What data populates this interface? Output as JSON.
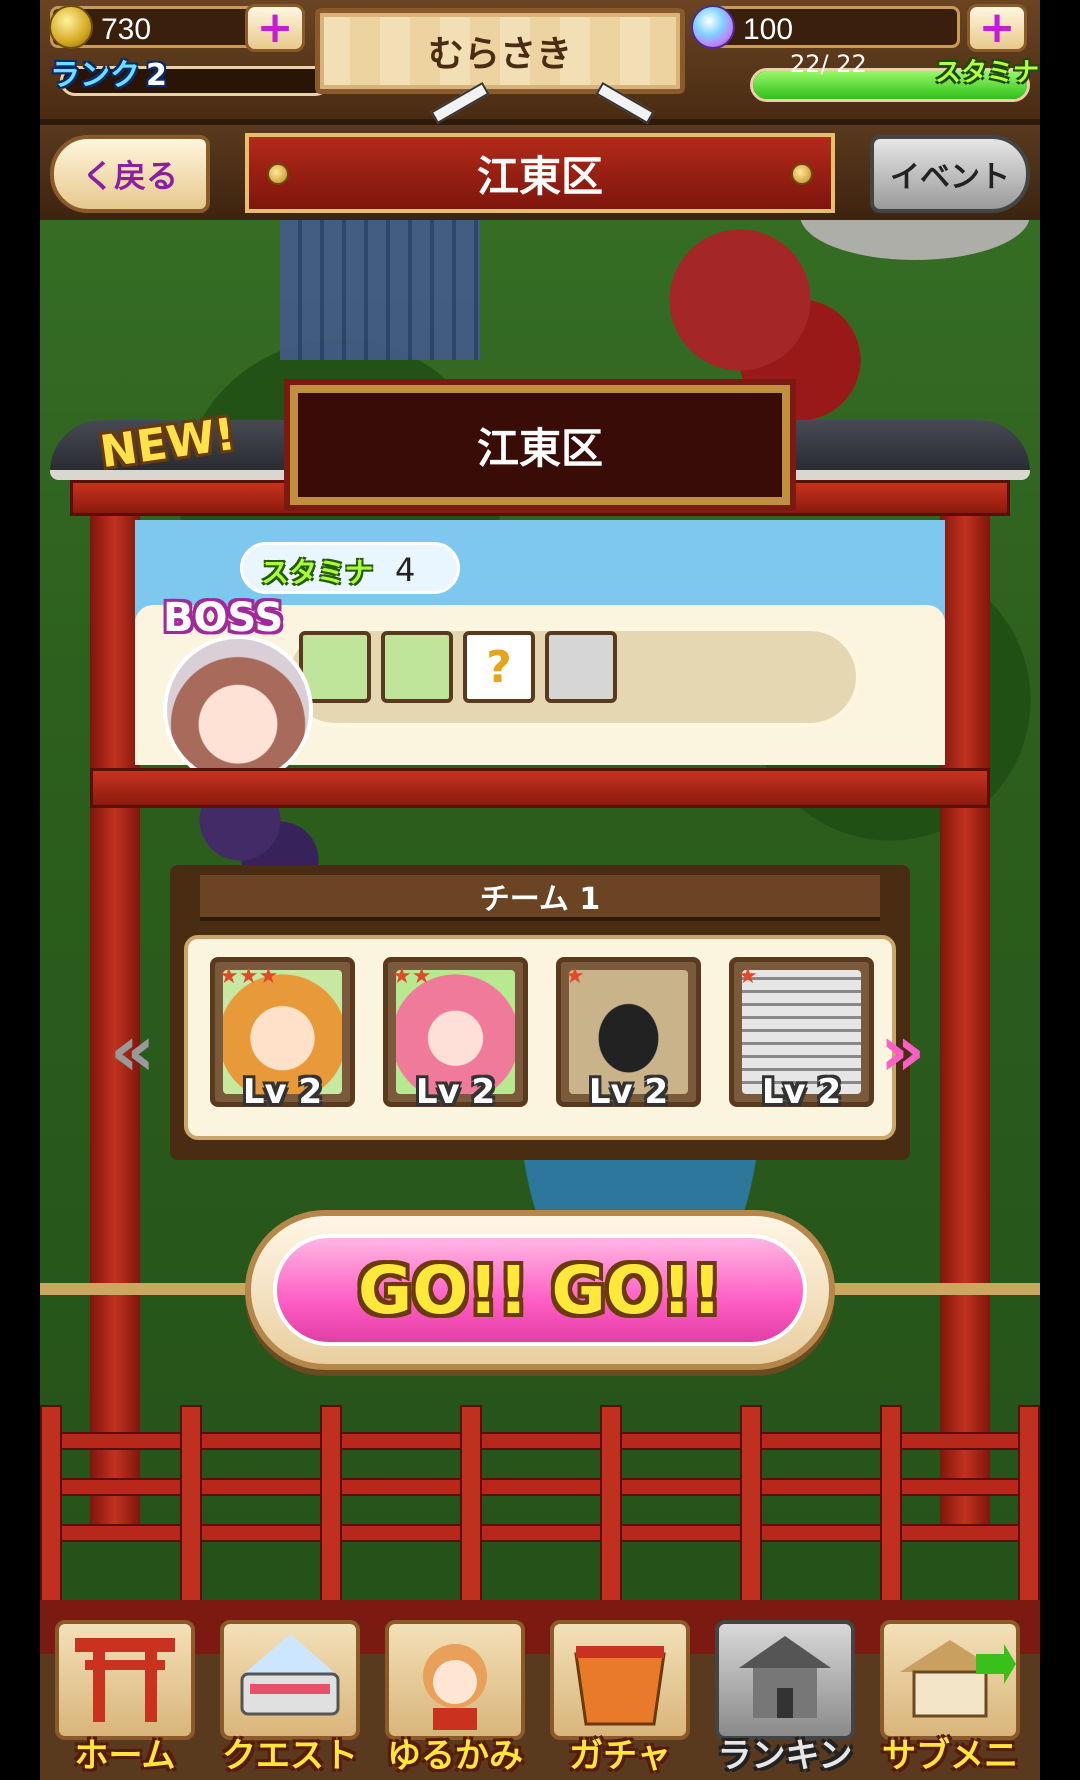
{
  "topbar": {
    "coins": "730",
    "rank_label": "ランク",
    "rank_value": "2",
    "player_name": "むらさき",
    "gems": "100",
    "stamina_current_max": "22/ 22",
    "stamina_label": "スタミナ",
    "stamina_fraction": 1.0
  },
  "header": {
    "back_label": "く戻る",
    "area_title": "江東区",
    "event_label": "イベント"
  },
  "quest": {
    "new_badge": "NEW!",
    "title": "江東区",
    "stamina_label": "スタミナ",
    "stamina_cost": "4",
    "boss_label": "BOSS",
    "drops": [
      "dog-card-icon",
      "rabbit-card-icon",
      "unknown",
      "building-card-icon"
    ],
    "unknown_symbol": "?"
  },
  "team": {
    "title": "チーム 1",
    "members": [
      {
        "stars": "★★★",
        "level": "Lv 2",
        "icon": "girl-orange-hair-icon"
      },
      {
        "stars": "★★",
        "level": "Lv 2",
        "icon": "girl-pink-hair-icon"
      },
      {
        "stars": "★",
        "level": "Lv 2",
        "icon": "crow-icon"
      },
      {
        "stars": "★",
        "level": "Lv 2",
        "icon": "building-icon"
      }
    ]
  },
  "go_button": {
    "label": "GO!! GO!!"
  },
  "nav": [
    {
      "label": "ホーム",
      "icon": "torii-icon"
    },
    {
      "label": "クエスト",
      "icon": "train-icon"
    },
    {
      "label": "ゆるかみ",
      "icon": "character-icon"
    },
    {
      "label": "ガチャ",
      "icon": "offering-box-icon"
    },
    {
      "label": "ランキング",
      "icon": "castle-icon"
    },
    {
      "label": "サブメニュー",
      "icon": "signboard-icon"
    }
  ],
  "colors": {
    "accent_pink": "#ff5fc4",
    "torii_red": "#c23220",
    "stamina_green": "#2fc01a"
  }
}
